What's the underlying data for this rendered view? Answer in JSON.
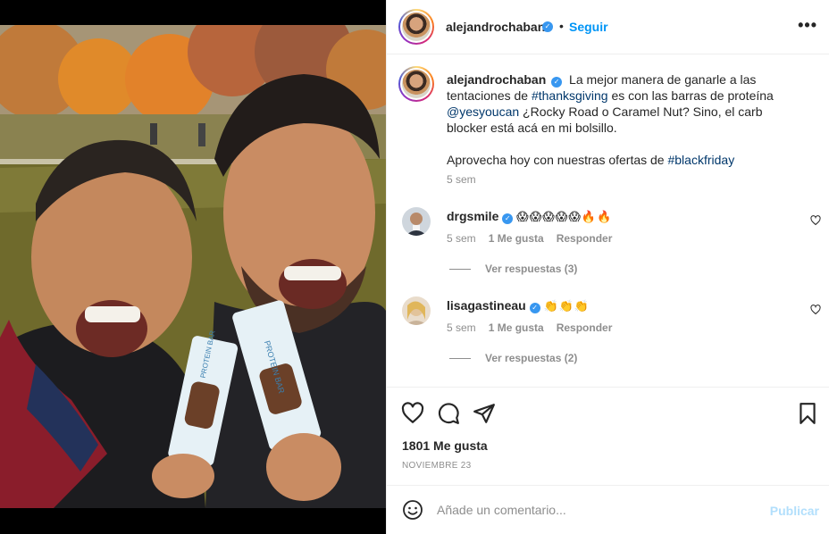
{
  "post": {
    "author": "alejandrochaban",
    "follow_label": "Seguir",
    "separator": "•",
    "more_label": "•••"
  },
  "caption": {
    "author": "alejandrochaban",
    "line1_pre": "La mejor manera de ganarle a las tentaciones de ",
    "hashtag1": "#thanksgiving",
    "line1_mid": " es con las barras de proteína ",
    "mention": "@yesyoucan",
    "line1_post": " ¿Rocky Road o Caramel Nut? Sino, el carb blocker está acá en mi bolsillo.",
    "line2_pre": "Aprovecha hoy con nuestras ofertas de ",
    "hashtag2": "#blackfriday",
    "time": "5 sem"
  },
  "comments": [
    {
      "author": "drgsmile",
      "text": "😱😱😱😱😱🔥🔥",
      "time": "5 sem",
      "likes": "1 Me gusta",
      "reply_label": "Responder",
      "view_replies": "Ver respuestas (3)"
    },
    {
      "author": "lisagastineau",
      "text": "👏👏👏",
      "time": "5 sem",
      "likes": "1 Me gusta",
      "reply_label": "Responder",
      "view_replies": "Ver respuestas (2)"
    }
  ],
  "engagement": {
    "likes": "1801 Me gusta",
    "date": "NOVIEMBRE 23"
  },
  "composer": {
    "placeholder": "Añade un comentario...",
    "publish_label": "Publicar"
  },
  "colors": {
    "link_blue": "#0095f6",
    "hashtag": "#00376b",
    "verified": "#3897f0",
    "muted": "#8e8e8e",
    "publish_disabled": "#b2dffc"
  },
  "icons": {
    "like": "heart-icon",
    "comment": "comment-bubble-icon",
    "share": "paper-plane-icon",
    "save": "bookmark-icon",
    "emoji": "smiley-icon",
    "verified": "verified-badge-icon"
  }
}
